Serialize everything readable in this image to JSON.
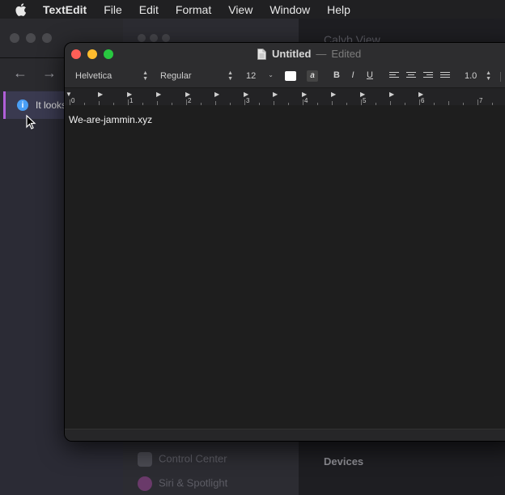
{
  "menubar": {
    "apple_icon": "apple-logo-icon",
    "app_name": "TextEdit",
    "items": [
      "File",
      "Edit",
      "Format",
      "View",
      "Window",
      "Help"
    ]
  },
  "background_left": {
    "back_icon": "arrow-left-icon",
    "forward_icon": "arrow-right-icon",
    "notice_icon": "info-icon",
    "notice_icon_glyph": "i",
    "notice_text": "It looks"
  },
  "background_right": {
    "header_faded": "Calyb View",
    "sidebar_items": [
      "Control Center",
      "Siri & Spotlight"
    ],
    "devices_label": "Devices"
  },
  "textedit": {
    "title": "Untitled",
    "title_separator": "—",
    "title_status": "Edited",
    "toolbar": {
      "font_family": "Helvetica",
      "font_style": "Regular",
      "font_size": "12",
      "bold_label": "B",
      "italic_label": "I",
      "underline_label": "U",
      "bg_color_label": "a",
      "line_spacing": "1.0"
    },
    "ruler_numbers": [
      "0",
      "1",
      "2",
      "3",
      "4",
      "5",
      "6",
      "7"
    ],
    "document_text": "We-are-jammin.xyz"
  },
  "colors": {
    "close": "#fe5f57",
    "minimize": "#febc2e",
    "maximize": "#28c840",
    "notice_accent": "#b05fd8",
    "info_blue": "#4a9ff5"
  }
}
